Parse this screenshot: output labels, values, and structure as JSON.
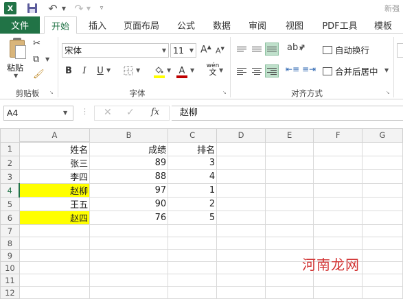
{
  "title_bar": {
    "app_logo": "X",
    "right_text": "新强"
  },
  "tabs": [
    "开始",
    "插入",
    "页面布局",
    "公式",
    "数据",
    "审阅",
    "视图",
    "PDF工具",
    "模板"
  ],
  "file_tab": "文件",
  "ribbon": {
    "clipboard": {
      "paste_label": "粘贴",
      "group_label": "剪贴板"
    },
    "font": {
      "font_name": "宋体",
      "font_size": "11",
      "wen_top": "wén",
      "wen_bottom": "文",
      "group_label": "字体",
      "fill_color": "#ffff00",
      "font_color": "#c00000"
    },
    "alignment": {
      "wrap_label": "自动换行",
      "merge_label": "合并后居中",
      "group_label": "对齐方式"
    }
  },
  "formula_bar": {
    "name_box": "A4",
    "fx": "fx",
    "formula": "赵柳"
  },
  "sheet": {
    "columns": [
      "A",
      "B",
      "C",
      "D",
      "E",
      "F",
      "G"
    ],
    "rows": [
      {
        "num": "1",
        "a": "姓名",
        "b": "成绩",
        "c": "排名",
        "highlight": false
      },
      {
        "num": "2",
        "a": "张三",
        "b": "89",
        "c": "3",
        "highlight": false
      },
      {
        "num": "3",
        "a": "李四",
        "b": "88",
        "c": "4",
        "highlight": false
      },
      {
        "num": "4",
        "a": "赵柳",
        "b": "97",
        "c": "1",
        "highlight": true
      },
      {
        "num": "5",
        "a": "王五",
        "b": "90",
        "c": "2",
        "highlight": false
      },
      {
        "num": "6",
        "a": "赵四",
        "b": "76",
        "c": "5",
        "highlight": true
      },
      {
        "num": "7",
        "a": "",
        "b": "",
        "c": "",
        "highlight": false
      },
      {
        "num": "8",
        "a": "",
        "b": "",
        "c": "",
        "highlight": false
      },
      {
        "num": "9",
        "a": "",
        "b": "",
        "c": "",
        "highlight": false
      },
      {
        "num": "10",
        "a": "",
        "b": "",
        "c": "",
        "highlight": false
      },
      {
        "num": "11",
        "a": "",
        "b": "",
        "c": "",
        "highlight": false
      },
      {
        "num": "12",
        "a": "",
        "b": "",
        "c": "",
        "highlight": false
      }
    ],
    "highlight_color": "#ffff00",
    "active_cell": "A4"
  },
  "watermark": "河南龙网"
}
